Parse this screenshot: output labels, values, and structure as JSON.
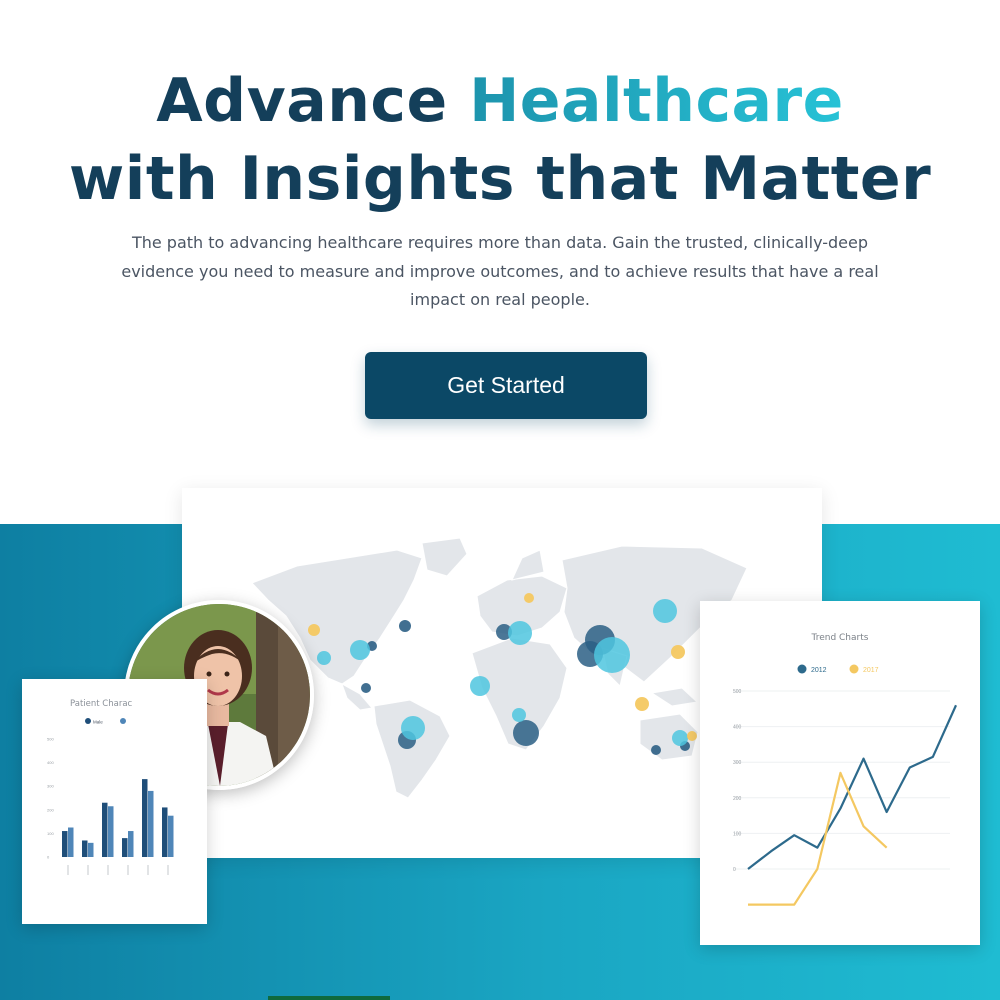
{
  "hero": {
    "title_part1": "Advance ",
    "title_accent": "Healthcare",
    "title_line2": "with Insights that Matter",
    "subtitle": "The path to advancing healthcare requires more than data. Gain the trusted, clinically-deep evidence you need to measure and improve outcomes, and to achieve results that have a real impact on real people.",
    "cta_label": "Get Started"
  },
  "colors": {
    "navy": "#143f5a",
    "button": "#0b4866",
    "teal": "#1fbcd2",
    "series_2012": "#2d6a8c",
    "series_2017": "#f4c861",
    "map_land": "#e3e6ea",
    "bubble_light": "#4fc6df",
    "bubble_dark": "#2c5f85"
  },
  "map": {
    "name": "world-map",
    "bubbles_shown": "dark-blue, light-blue and yellow bubbles"
  },
  "avatar": {
    "alt": "doctor-photo"
  },
  "chart_data": [
    {
      "type": "bar",
      "title": "Patient Charac",
      "legend": [
        "Male",
        ""
      ],
      "categories": [
        "c1",
        "c2",
        "c3",
        "c4",
        "c5",
        "c6"
      ],
      "series": [
        {
          "name": "Male",
          "values": [
            110,
            70,
            230,
            80,
            330,
            210
          ]
        },
        {
          "name": "",
          "values": [
            125,
            60,
            215,
            110,
            280,
            175
          ]
        }
      ],
      "yticks": [
        "0",
        "100",
        "200",
        "300",
        "400",
        "500"
      ],
      "ylim": [
        0,
        500
      ]
    },
    {
      "type": "line",
      "title": "Trend Charts",
      "legend": [
        "2012",
        "2017"
      ],
      "yticks": [
        "0",
        "100",
        "200",
        "300",
        "400",
        "500"
      ],
      "ylim": [
        0,
        500
      ],
      "x": [
        0,
        1,
        2,
        3,
        4,
        5,
        6,
        7,
        8,
        9
      ],
      "series": [
        {
          "name": "2012",
          "values": [
            0,
            50,
            95,
            60,
            170,
            310,
            160,
            285,
            315,
            460
          ]
        },
        {
          "name": "2017",
          "values": [
            -100,
            -100,
            -100,
            0,
            270,
            120,
            60
          ]
        }
      ]
    }
  ]
}
